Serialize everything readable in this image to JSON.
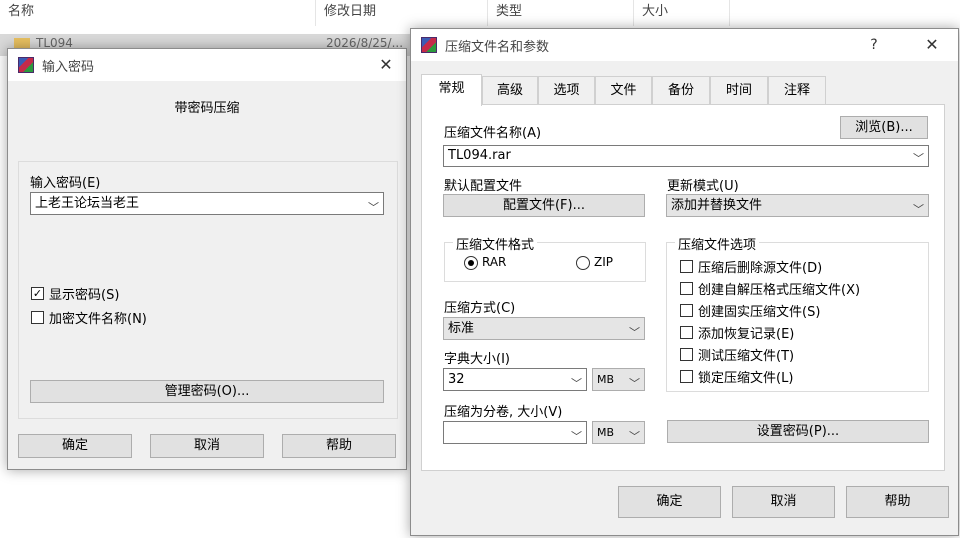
{
  "explorer": {
    "columns": [
      "名称",
      "修改日期",
      "类型",
      "大小"
    ],
    "file_name": "TL094",
    "file_date": "2026/8/25/..."
  },
  "password_dialog": {
    "title": "输入密码",
    "heading": "带密码压缩",
    "password_label": "输入密码(E)",
    "password_value": "上老王论坛当老王",
    "show_password_label": "显示密码(S)",
    "show_password_checked": true,
    "encrypt_names_label": "加密文件名称(N)",
    "encrypt_names_checked": false,
    "manage_button": "管理密码(O)...",
    "ok": "确定",
    "cancel": "取消",
    "help": "帮助"
  },
  "archive_dialog": {
    "title": "压缩文件名和参数",
    "help_glyph": "?",
    "tabs": [
      "常规",
      "高级",
      "选项",
      "文件",
      "备份",
      "时间",
      "注释"
    ],
    "active_tab": 0,
    "archive_name_label": "压缩文件名称(A)",
    "browse_button": "浏览(B)...",
    "archive_name_value": "TL094.rar",
    "default_profile_label": "默认配置文件",
    "profile_button": "配置文件(F)...",
    "update_mode_label": "更新模式(U)",
    "update_mode_value": "添加并替换文件",
    "format_group": "压缩文件格式",
    "format_rar": "RAR",
    "format_zip": "ZIP",
    "format_selected": "RAR",
    "method_label": "压缩方式(C)",
    "method_value": "标准",
    "dict_label": "字典大小(I)",
    "dict_value": "32",
    "dict_unit": "MB",
    "split_label": "压缩为分卷, 大小(V)",
    "split_value": "",
    "split_unit": "MB",
    "options_group": "压缩文件选项",
    "options": [
      {
        "label": "压缩后删除源文件(D)",
        "checked": false
      },
      {
        "label": "创建自解压格式压缩文件(X)",
        "checked": false
      },
      {
        "label": "创建固实压缩文件(S)",
        "checked": false
      },
      {
        "label": "添加恢复记录(E)",
        "checked": false
      },
      {
        "label": "测试压缩文件(T)",
        "checked": false
      },
      {
        "label": "锁定压缩文件(L)",
        "checked": false
      }
    ],
    "set_password_button": "设置密码(P)...",
    "ok": "确定",
    "cancel": "取消",
    "help": "帮助"
  }
}
